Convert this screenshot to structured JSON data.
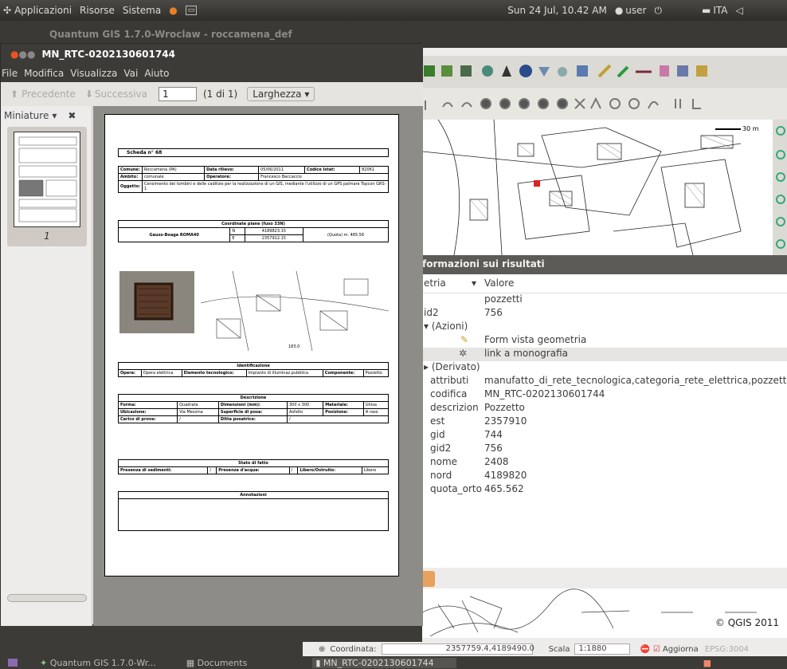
{
  "topbar": {
    "menus": [
      "Applicazioni",
      "Risorse",
      "Sistema"
    ],
    "datetime": "Sun 24 Jul, 10.42 AM",
    "user": "user",
    "lang": "ITA"
  },
  "qgis": {
    "title": "Quantum GIS 1.7.0-Wroclaw - roccamena_def",
    "info_panel": {
      "title": "formazioni sui risultati",
      "col_key": "etria",
      "col_value": "Valore",
      "rows": [
        {
          "k": "",
          "v": "pozzetti"
        },
        {
          "k": "id2",
          "v": "756"
        },
        {
          "k": "▾ (Azioni)",
          "v": ""
        },
        {
          "k": "",
          "v": "Form vista geometria"
        },
        {
          "k": "",
          "v": "link a monografia"
        },
        {
          "k": "▸ (Derivato)",
          "v": ""
        },
        {
          "k": "attributi",
          "v": "manufatto_di_rete_tecnologica,categoria_rete_elettrica,pozzetto"
        },
        {
          "k": "codifica",
          "v": "MN_RTC-0202130601744"
        },
        {
          "k": "descrizion",
          "v": "Pozzetto"
        },
        {
          "k": "est",
          "v": "2357910"
        },
        {
          "k": "gid",
          "v": "744"
        },
        {
          "k": "gid2",
          "v": "756"
        },
        {
          "k": "nome",
          "v": "2408"
        },
        {
          "k": "nord",
          "v": "4189820"
        },
        {
          "k": "quota_orto",
          "v": "465.562"
        }
      ]
    },
    "credit": "© QGIS 2011",
    "status": {
      "coord_label": "Coordinata:",
      "coord_value": "2357759.4,4189490.0",
      "scale_label": "Scala",
      "scale_value": "1:1880",
      "render_label": "Aggiorna",
      "epsg": "EPSG:3004"
    },
    "scalebar": "30 m"
  },
  "taskbar": {
    "items": [
      "Quantum GIS 1.7.0-Wr...",
      "Documents",
      "MN_RTC-0202130601744"
    ]
  },
  "evince": {
    "title": "MN_RTC-0202130601744",
    "menu": [
      "File",
      "Modifica",
      "Visualizza",
      "Vai",
      "Aiuto"
    ],
    "toolbar": {
      "prev": "Precedente",
      "next": "Successiva",
      "page": "1",
      "page_of": "(1 di 1)",
      "zoom": "Larghezza"
    },
    "sidebar": {
      "mode": "Miniature",
      "thumb_label": "1"
    },
    "doc": {
      "scheda": "Scheda n° 68",
      "comune_l": "Comune:",
      "comune_v": "Roccamena (PA)",
      "data_l": "Data rilievo:",
      "data_v": "05/06/2011",
      "codice_l": "Codice Istat:",
      "codice_v": "82061",
      "ambito_l": "Ambito:",
      "ambito_v": "comunale",
      "operatore_l": "Operatore:",
      "operatore_v": "Francesco Baccaccio",
      "oggetto_l": "Oggetto:",
      "oggetto_v": "Censimento dei tombini e delle caditoie per la realizzazione di un GIS, mediante l'utilizzo di un GPS palmare Topcon GRS-1",
      "coord_title": "Coordinate piane (fuso 33N)",
      "gauss": "Gauss-Boaga ROMA40",
      "n_l": "N",
      "n_v": "4189823.15",
      "e_l": "E",
      "e_v": "2357912.15",
      "quota": "(Quota) m. 465.56",
      "ident_title": "Identificazione",
      "opera_l": "Opera:",
      "opera_v": "Opera elettrica",
      "elem_l": "Elemento tecnologico:",
      "elem_v": "Impianto di illuminaz.pubblica",
      "comp_l": "Componente:",
      "comp_v": "Pozzetto",
      "desc_title": "Descrizione",
      "forma_l": "Forma:",
      "forma_v": "Quadrata",
      "dim_l": "Dimensioni (mm):",
      "dim_v": "300 x 300",
      "mat_l": "Materiale:",
      "mat_v": "Ghisa",
      "ubic_l": "Ubicazione:",
      "ubic_v": "Via Messina",
      "sup_l": "Superficie di posa:",
      "sup_v": "Asfalto",
      "pos_l": "Posizione:",
      "pos_v": "A raso",
      "carico_l": "Carico di prova:",
      "carico_v": "/",
      "ditta_l": "Ditta posatrice:",
      "ditta_v": "/",
      "stato_title": "Stato di fatto",
      "sed_l": "Presenza di sedimenti:",
      "sed_v": "/",
      "acq_l": "Presenza d'acqua:",
      "acq_v": "/",
      "lib_l": "Libero/Ostruito:",
      "lib_v": "Libero",
      "annot_title": "Annotazioni"
    }
  }
}
